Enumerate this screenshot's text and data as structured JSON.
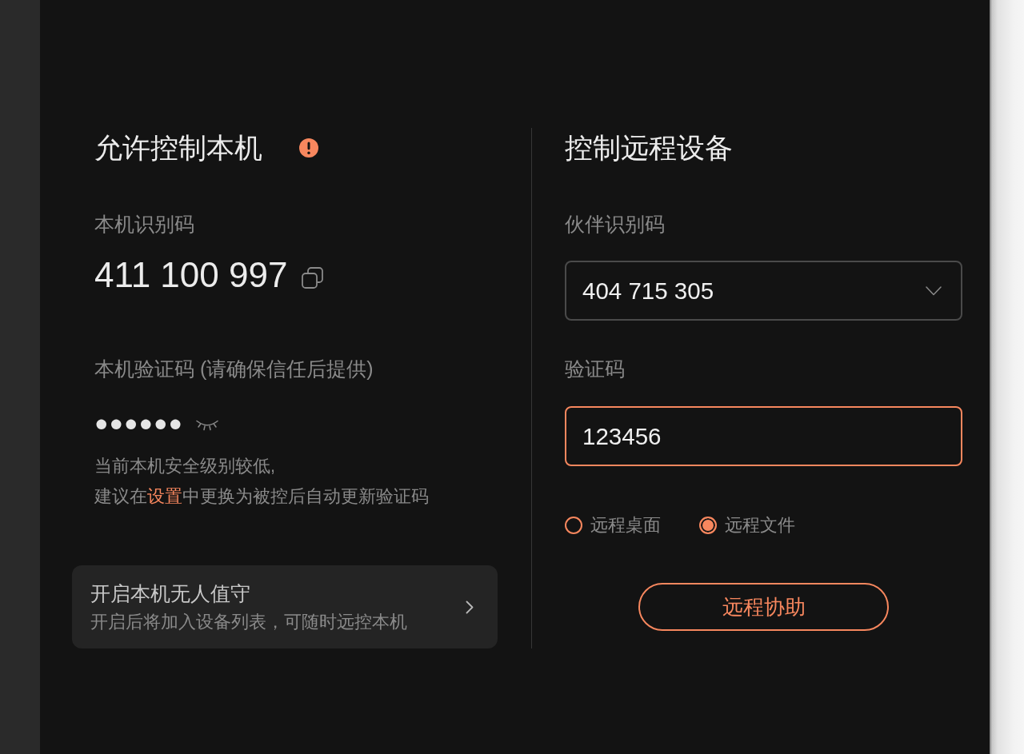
{
  "local": {
    "title": "允许控制本机",
    "id_label": "本机识别码",
    "id": "411 100 997",
    "code_label": "本机验证码 (请确保信任后提供)",
    "code_masked": "●●●●●●",
    "hint": {
      "lines": [
        [
          {
            "kind": "text",
            "text": "当前本机安全级别较低,"
          }
        ],
        [
          {
            "kind": "text",
            "text": "建议在"
          },
          {
            "kind": "link",
            "text": "设置"
          },
          {
            "kind": "text",
            "text": "中更换为被控后自动更新验证码"
          }
        ]
      ]
    },
    "unattended": {
      "title": "开启本机无人值守",
      "subtitle": "开启后将加入设备列表，可随时远控本机"
    }
  },
  "remote": {
    "title": "控制远程设备",
    "partner_label": "伙伴识别码",
    "partner_id": {
      "value": "404 715 305",
      "focused": false
    },
    "code_label": "验证码",
    "code": {
      "value": "123456",
      "focused": true
    },
    "modes": [
      {
        "label": "远程桌面",
        "selected": false
      },
      {
        "label": "远程文件",
        "selected": true
      }
    ],
    "button": "远程协助"
  }
}
